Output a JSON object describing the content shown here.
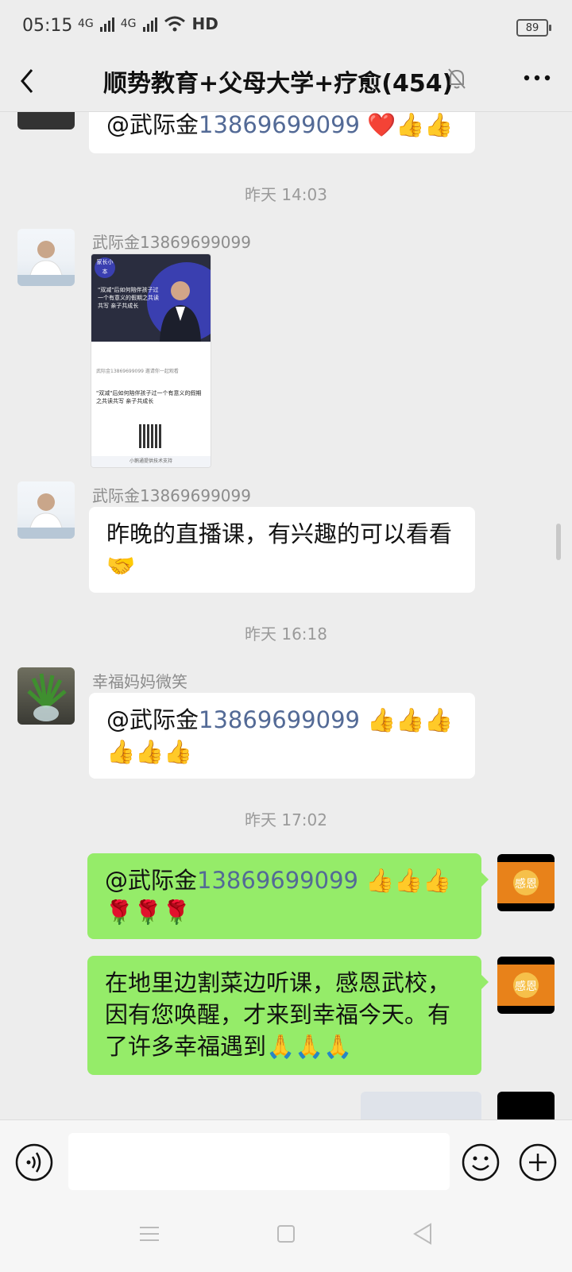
{
  "status_bar": {
    "time": "05:15",
    "network_1": "4G",
    "network_2": "4G",
    "hd": "HD",
    "battery": "89"
  },
  "header": {
    "title": "顺势教育+父母大学+疗愈(454)",
    "mute_icon": "bell-off-icon",
    "more_icon": "more-dots-icon",
    "back_icon": "chevron-left-icon"
  },
  "messages": {
    "m0": {
      "mention": "@武际金",
      "phone": "13869699099",
      "emoji": "❤️👍👍"
    },
    "ts1": "昨天 14:03",
    "m1": {
      "sender": "武际金13869699099",
      "card": {
        "tag": "家长小本",
        "title": "\"双减\"后如何陪伴孩子过一个有意义的假期之共读共写 亲子共成长",
        "meta": "武际金13869699099 邀请你一起观看",
        "quote": "\"双减\"后如何陪伴孩子过一个有意义的假期之共读共写 亲子共成长",
        "footer": "小鹅通提供技术支持"
      }
    },
    "m2": {
      "sender": "武际金13869699099",
      "text": "昨晚的直播课，有兴趣的可以看看🤝"
    },
    "ts2": "昨天 16:18",
    "m3": {
      "sender": "幸福妈妈微笑",
      "mention": "@武际金",
      "phone": "13869699099",
      "emoji": "👍👍👍👍👍👍"
    },
    "ts3": "昨天 17:02",
    "m4": {
      "mention": "@武际金",
      "phone": "13869699099",
      "emoji": "👍👍👍🌹🌹🌹"
    },
    "m5": {
      "text": "在地里边割菜边听课，感恩武校，因有您唤醒，才来到幸福今天。有了许多幸福遇到🙏🙏🙏"
    },
    "self_avatar_text": "感恩"
  },
  "input_bar": {
    "placeholder": "",
    "voice_icon": "voice-icon",
    "emoji_icon": "emoji-icon",
    "plus_icon": "plus-icon"
  },
  "colors": {
    "self_bubble": "#95ec69",
    "mention": "#536a96",
    "background": "#ededed"
  }
}
